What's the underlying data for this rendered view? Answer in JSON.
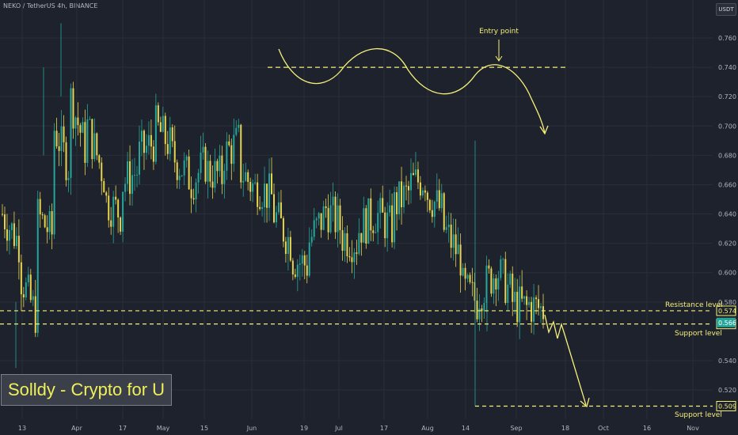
{
  "header": {
    "symbol": "NEKO / TetherUS 4h, BINANCE",
    "currency": "USDT"
  },
  "branding": {
    "watermark": "Solldy - Crypto for U"
  },
  "colors": {
    "background": "#1e222d",
    "up": "#26a69a",
    "down": "#e8d44d",
    "annotation": "#f5f07a",
    "grid": "#2a2e39"
  },
  "chart_data": {
    "type": "candlestick",
    "title": "",
    "xlabel": "",
    "ylabel": "",
    "ylim": [
      0.498,
      0.775
    ],
    "y_ticks": [
      "0.760",
      "0.740",
      "0.720",
      "0.700",
      "0.680",
      "0.660",
      "0.640",
      "0.620",
      "0.600",
      "0.580",
      "0.540",
      "0.520"
    ],
    "x_ticks": [
      "13",
      "Apr",
      "17",
      "May",
      "15",
      "Jun",
      "19",
      "Jul",
      "17",
      "Aug",
      "14",
      "Sep",
      "18",
      "Oct",
      "16",
      "Nov"
    ],
    "grid": true,
    "price_path": [
      [
        0.64,
        0.62
      ],
      [
        0.6,
        0.57
      ],
      [
        0.64,
        0.625
      ],
      [
        0.7,
        0.67
      ],
      [
        0.72,
        0.68
      ],
      [
        0.7,
        0.665
      ],
      [
        0.65,
        0.64
      ],
      [
        0.66,
        0.67
      ],
      [
        0.68,
        0.69
      ],
      [
        0.7,
        0.685
      ],
      [
        0.68,
        0.665
      ],
      [
        0.66,
        0.675
      ],
      [
        0.67,
        0.665
      ],
      [
        0.68,
        0.69
      ],
      [
        0.67,
        0.655
      ],
      [
        0.66,
        0.65
      ],
      [
        0.64,
        0.62
      ],
      [
        0.61,
        0.605
      ],
      [
        0.62,
        0.64
      ],
      [
        0.645,
        0.63
      ],
      [
        0.625,
        0.62
      ],
      [
        0.63,
        0.64
      ],
      [
        0.64,
        0.63
      ],
      [
        0.645,
        0.655
      ],
      [
        0.66,
        0.665
      ],
      [
        0.655,
        0.64
      ],
      [
        0.63,
        0.61
      ],
      [
        0.59,
        0.58
      ],
      [
        0.585,
        0.6
      ],
      [
        0.605,
        0.585
      ],
      [
        0.58,
        0.575
      ],
      [
        0.578,
        0.574
      ]
    ],
    "annotations": {
      "entry_label": "Entry point",
      "resistance_label": "Resistance level",
      "support_label_1": "Support level",
      "support_label_2": "Support level"
    },
    "levels": [
      {
        "name": "resistance",
        "value": 0.574,
        "label": "0.574"
      },
      {
        "name": "support",
        "value": 0.565,
        "label": "0.565"
      },
      {
        "name": "support-lower",
        "value": 0.509,
        "label": "0.509"
      }
    ],
    "entry_level": 0.74,
    "current_price": {
      "value": 0.566,
      "label": "0.566"
    }
  }
}
